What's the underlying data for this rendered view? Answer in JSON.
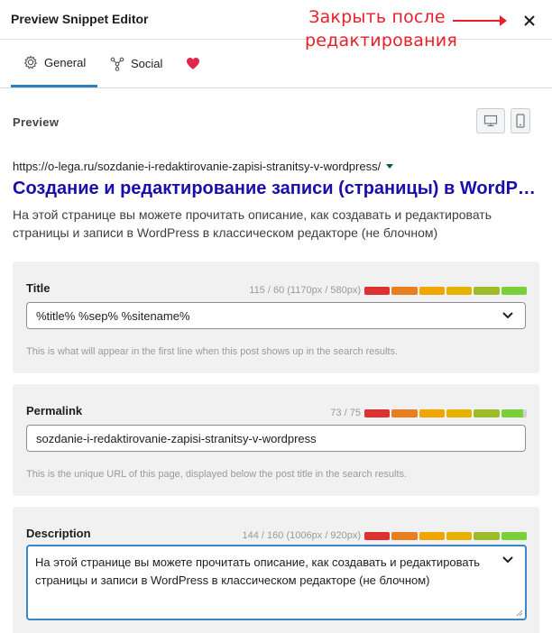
{
  "header": {
    "title": "Preview Snippet Editor",
    "annotation_line1": "Закрыть после",
    "annotation_line2": "редактирования",
    "annotation_color": "#e8202a"
  },
  "tabs": [
    {
      "label": "General",
      "icon": "gear-icon",
      "active": true
    },
    {
      "label": "Social",
      "icon": "share-icon",
      "active": false
    },
    {
      "label": "",
      "icon": "heart-icon",
      "active": false
    }
  ],
  "preview": {
    "label": "Preview",
    "url": "https://o-lega.ru/sozdanie-i-redaktirovanie-zapisi-stranitsy-v-wordpress/",
    "title": "Создание и редактирование записи (страницы) в WordPress в классическом редакторе",
    "description": "На этой странице вы можете прочитать описание, как создавать и редактировать страницы и записи в WordPress в классическом редакторе (не блочном)"
  },
  "fields": {
    "title": {
      "label": "Title",
      "counter": "115 / 60 (1170px / 580px)",
      "value": "%title% %sep% %sitename%",
      "hint": "This is what will appear in the first line when this post shows up in the search results."
    },
    "permalink": {
      "label": "Permalink",
      "counter": "73 / 75",
      "value": "sozdanie-i-redaktirovanie-zapisi-stranitsy-v-wordpress",
      "hint": "This is the unique URL of this page, displayed below the post title in the search results."
    },
    "description": {
      "label": "Description",
      "counter": "144 / 160 (1006px / 920px)",
      "value": "На этой странице вы можете прочитать описание, как создавать и редактировать страницы и записи в WordPress в классическом редакторе (не блочном)"
    }
  },
  "colors": {
    "accent": "#2d7ec2",
    "link": "#1a0dab",
    "heart": "#e2264d"
  }
}
